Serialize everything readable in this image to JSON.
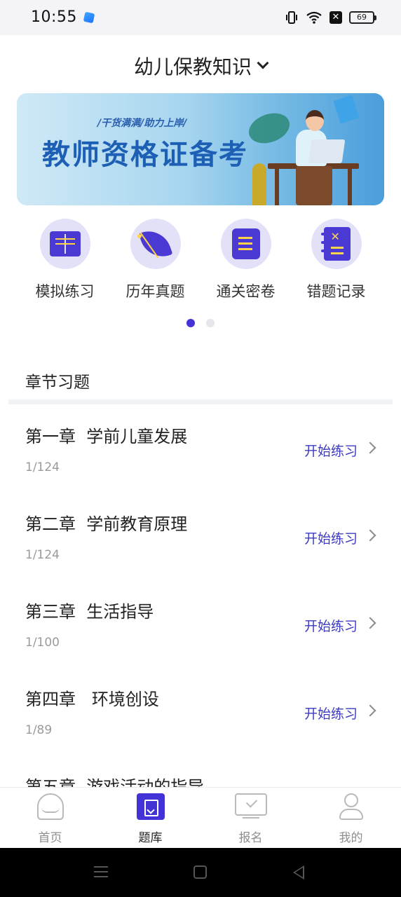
{
  "status_bar": {
    "time": "10:55",
    "battery": "69",
    "icons": [
      "vibrate-icon",
      "wifi-icon",
      "close-box-icon",
      "battery-icon"
    ]
  },
  "header": {
    "title": "幼儿保教知识"
  },
  "banner": {
    "slogan": "/干货满满/助力上岸/",
    "title": "教师资格证备考"
  },
  "quick_menu": [
    {
      "label": "模拟练习",
      "icon": "book-icon"
    },
    {
      "label": "历年真题",
      "icon": "leaf-icon"
    },
    {
      "label": "通关密卷",
      "icon": "notebook-icon"
    },
    {
      "label": "错题记录",
      "icon": "wrong-notes-icon"
    }
  ],
  "page_indicator": {
    "current": 1,
    "total": 2
  },
  "section": {
    "title": "章节习题"
  },
  "chapters": [
    {
      "name": "第一章  学前儿童发展",
      "progress": "1/124",
      "action": "开始练习"
    },
    {
      "name": "第二章  学前教育原理",
      "progress": "1/124",
      "action": "开始练习"
    },
    {
      "name": "第三章  生活指导",
      "progress": "1/100",
      "action": "开始练习"
    },
    {
      "name": "第四章   环境创设",
      "progress": "1/89",
      "action": "开始练习"
    },
    {
      "name": "第五章  游戏活动的指导",
      "progress": "",
      "action": ""
    }
  ],
  "tab_bar": [
    {
      "label": "首页",
      "icon": "home-icon",
      "active": false
    },
    {
      "label": "题库",
      "icon": "question-bank-icon",
      "active": true
    },
    {
      "label": "报名",
      "icon": "register-icon",
      "active": false
    },
    {
      "label": "我的",
      "icon": "profile-icon",
      "active": false
    }
  ],
  "colors": {
    "accent": "#4332d6",
    "icon_bg": "#e3e1f7",
    "icon_highlight": "#ffd44a",
    "action_text": "#3d3ac2"
  }
}
